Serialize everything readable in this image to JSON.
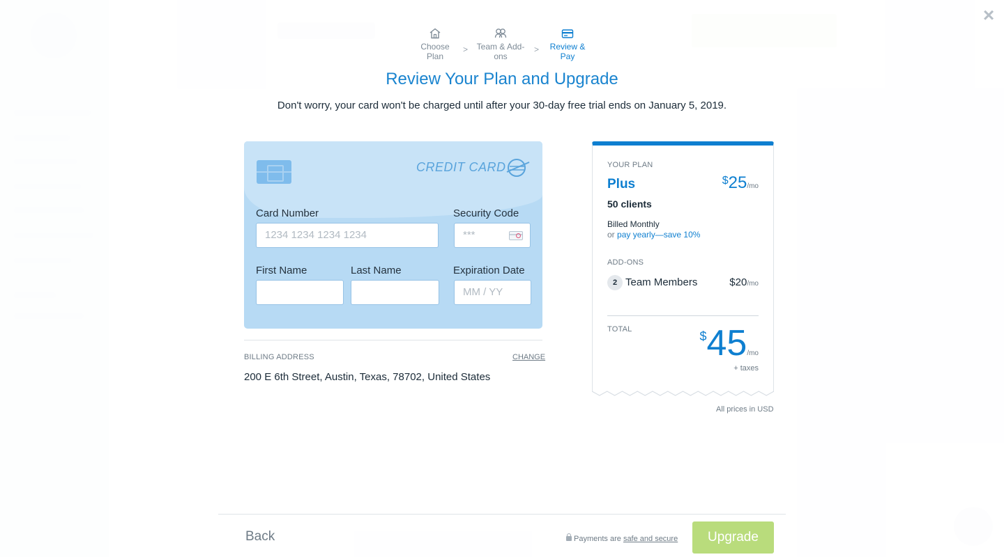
{
  "stepper": {
    "steps": [
      {
        "label": "Choose Plan",
        "icon": "house-icon"
      },
      {
        "label": "Team & Add-ons",
        "icon": "team-icon"
      },
      {
        "label": "Review & Pay",
        "icon": "credit-card-icon"
      }
    ],
    "active_index": 2
  },
  "heading": {
    "title": "Review Your Plan and Upgrade",
    "subtitle": "Don't worry, your card won't be charged until after your 30-day free trial ends on January 5, 2019."
  },
  "card_form": {
    "brand_label": "CREDIT CARD",
    "card_number": {
      "label": "Card Number",
      "placeholder": "1234 1234 1234 1234",
      "value": ""
    },
    "security_code": {
      "label": "Security Code",
      "placeholder": "***",
      "value": ""
    },
    "first_name": {
      "label": "First Name",
      "value": ""
    },
    "last_name": {
      "label": "Last Name",
      "value": ""
    },
    "expiration": {
      "label": "Expiration Date",
      "placeholder": "MM / YY",
      "value": ""
    }
  },
  "billing": {
    "label": "BILLING ADDRESS",
    "change_label": "CHANGE",
    "address": "200 E 6th Street, Austin, Texas, 78702, United States"
  },
  "plan": {
    "section_label": "YOUR PLAN",
    "name": "Plus",
    "clients": "50 clients",
    "currency": "$",
    "price": "25",
    "per": "/mo",
    "billed": "Billed Monthly",
    "yearly_prefix": "or",
    "yearly_link": "pay yearly—save 10%"
  },
  "addons": {
    "section_label": "ADD-ONS",
    "items": [
      {
        "count": "2",
        "name": "Team Members",
        "price": "$20",
        "per": "/mo"
      }
    ]
  },
  "total": {
    "label": "TOTAL",
    "currency": "$",
    "amount": "45",
    "per": "/mo",
    "taxes": "+ taxes"
  },
  "usd_note": "All prices in USD",
  "footer": {
    "back_label": "Back",
    "secure_prefix": "Payments are",
    "secure_link": "safe and secure",
    "upgrade_label": "Upgrade"
  },
  "close_icon": "×",
  "colors": {
    "accent": "#0e7fd0",
    "card_bg": "#b7daf4",
    "upgrade_button": "#b9dc7c"
  }
}
